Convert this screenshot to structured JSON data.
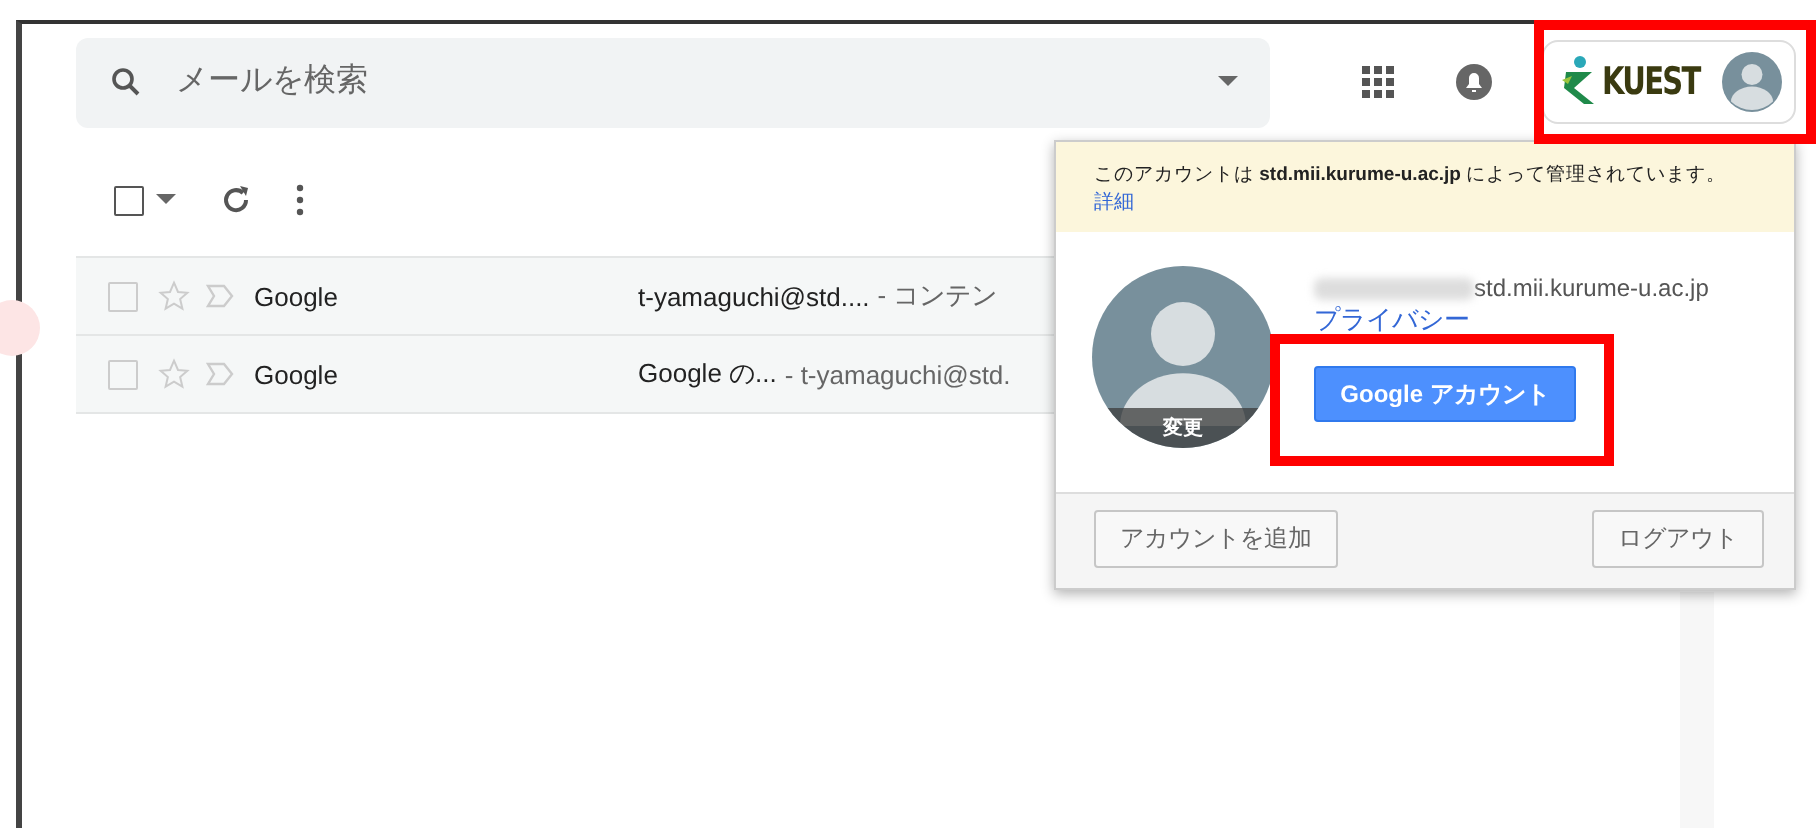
{
  "search": {
    "placeholder": "メールを検索"
  },
  "toolbar": {
    "select_all_checked": false
  },
  "emails": [
    {
      "sender": "Google",
      "subject": "t-yamaguchi@std....",
      "snippet": "- コンテン",
      "checked": false,
      "starred": false
    },
    {
      "sender": "Google",
      "subject": "Google の...",
      "snippet": "- t-yamaguchi@std.",
      "checked": false,
      "starred": false
    }
  ],
  "account_chip": {
    "logo_text": "KUEST"
  },
  "account_popup": {
    "notice": "このアカウントは **std.mii.kurume-u.ac.jp** によって管理されています。",
    "notice_link": "詳細",
    "avatar_label": "変更",
    "email_domain": "std.mii.kurume-u.ac.jp",
    "privacy_link": "プライバシー",
    "account_button": "Google アカウント",
    "add_account_button": "アカウントを追加",
    "logout_button": "ログアウト"
  }
}
